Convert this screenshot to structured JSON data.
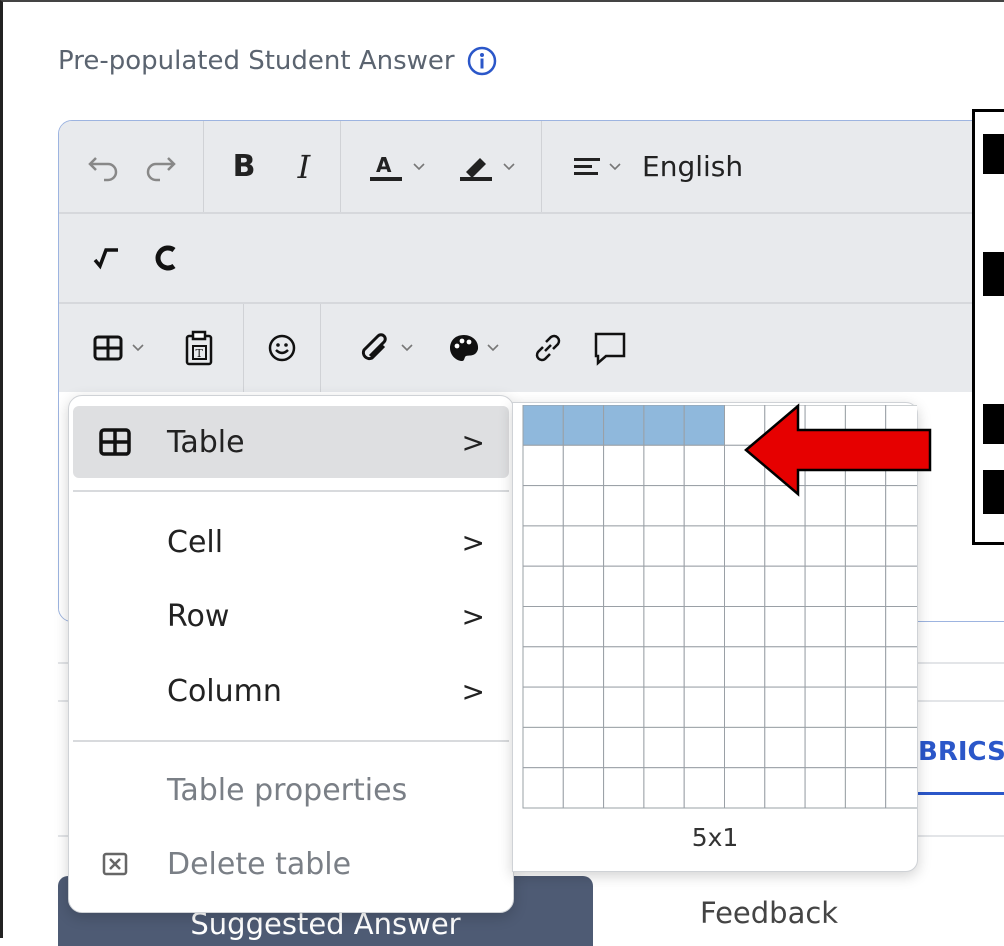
{
  "field": {
    "label": "Pre-populated Student Answer"
  },
  "toolbar": {
    "language": "English",
    "row1": [
      "undo-icon",
      "redo-icon",
      "bold-icon",
      "italic-icon",
      "text-color-icon",
      "highlight-icon",
      "align-icon"
    ],
    "row2": [
      "math-icon",
      "chemistry-icon"
    ],
    "row3": [
      "table-icon",
      "paste-text-icon",
      "emoji-icon",
      "attachment-icon",
      "palette-icon",
      "link-icon",
      "comment-icon"
    ]
  },
  "table_menu": {
    "items": [
      {
        "label": "Table",
        "submenu": true,
        "highlighted": true,
        "icon": "table-icon"
      },
      {
        "label": "Cell",
        "submenu": true
      },
      {
        "label": "Row",
        "submenu": true
      },
      {
        "label": "Column",
        "submenu": true
      },
      {
        "label": "Table properties",
        "disabled": true
      },
      {
        "label": "Delete table",
        "disabled": true,
        "icon": "delete-table-icon"
      }
    ]
  },
  "grid_picker": {
    "columns": 10,
    "rows": 10,
    "selected_cols": 5,
    "selected_rows": 1,
    "size_label": "5x1"
  },
  "tabs": {
    "rubrics": "BRICS",
    "suggested": "Suggested Answer",
    "feedback": "Feedback"
  },
  "colors": {
    "accent": "#2b57c9",
    "selection": "#8fb8dc",
    "arrow": "#e60000",
    "tab_active": "#4e5b74"
  }
}
